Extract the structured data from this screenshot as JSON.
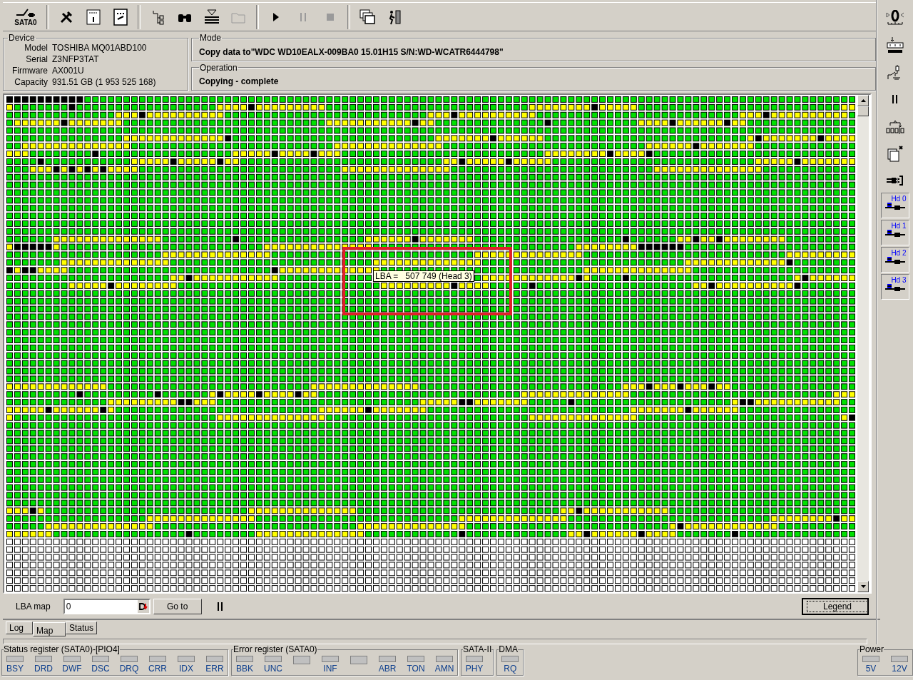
{
  "toolbar": {
    "port_button": {
      "label": "SATA0"
    },
    "buttons": [
      {
        "kind": "tools",
        "disabled": false
      },
      {
        "kind": "info",
        "disabled": false
      },
      {
        "kind": "percent",
        "disabled": false
      },
      {
        "kind": "tree",
        "disabled": false
      },
      {
        "kind": "binoculars",
        "disabled": false
      },
      {
        "kind": "stack",
        "disabled": false
      },
      {
        "kind": "folder",
        "disabled": true
      },
      {
        "kind": "play",
        "disabled": false
      },
      {
        "kind": "pause",
        "disabled": true
      },
      {
        "kind": "stop",
        "disabled": true
      },
      {
        "kind": "windows",
        "disabled": false
      },
      {
        "kind": "exit",
        "disabled": false
      }
    ]
  },
  "device": {
    "title": "Device",
    "fields": [
      {
        "label": "Model",
        "value": "TOSHIBA MQ01ABD100"
      },
      {
        "label": "Serial",
        "value": "Z3NFP3TAT"
      },
      {
        "label": "Firmware",
        "value": "AX001U"
      },
      {
        "label": "Capacity",
        "value": "931.51 GB (1 953 525 168)"
      }
    ]
  },
  "mode": {
    "title": "Mode",
    "text": "Copy data to\"WDC WD10EALX-009BA0 15.01H15 S/N:WD-WCATR6444798\""
  },
  "operation": {
    "title": "Operation",
    "text": "Copying - complete"
  },
  "map": {
    "tooltip": "LBA =   507 749 (Head 3)"
  },
  "map_controls": {
    "label": "LBA map",
    "value": "0",
    "go_button": "Go to",
    "legend_button": "Legend"
  },
  "tabs": [
    {
      "label": "Log",
      "selected": false
    },
    {
      "label": "Map",
      "selected": true
    },
    {
      "label": "Status",
      "selected": false
    }
  ],
  "side_toolbar": {
    "buttons": [
      {
        "kind": "zero"
      },
      {
        "kind": "reset"
      },
      {
        "kind": "switch"
      },
      {
        "kind": "pause"
      },
      {
        "kind": "counter"
      },
      {
        "kind": "pages"
      },
      {
        "kind": "cable"
      }
    ],
    "heads": [
      {
        "label": "Hd 0"
      },
      {
        "label": "Hd 1"
      },
      {
        "label": "Hd 2"
      },
      {
        "label": "Hd 3"
      }
    ]
  },
  "registers": [
    {
      "title": "Status register (SATA0)-[PIO4]",
      "indicators": [
        {
          "label": "BSY"
        },
        {
          "label": "DRD"
        },
        {
          "label": "DWF"
        },
        {
          "label": "DSC"
        },
        {
          "label": "DRQ"
        },
        {
          "label": "CRR"
        },
        {
          "label": "IDX"
        },
        {
          "label": "ERR"
        }
      ]
    },
    {
      "title": "Error register (SATA0)",
      "indicators": [
        {
          "label": "BBK"
        },
        {
          "label": "UNC"
        },
        {
          "kind": "unlabeled"
        },
        {
          "label": "INF"
        },
        {
          "kind": "unlabeled"
        },
        {
          "label": "ABR"
        },
        {
          "label": "TON"
        },
        {
          "label": "AMN"
        }
      ]
    },
    {
      "title": "SATA-II",
      "indicators": [
        {
          "label": "PHY"
        }
      ]
    },
    {
      "title": "DMA",
      "indicators": [
        {
          "label": "RQ"
        }
      ]
    },
    {
      "title": "Power",
      "indicators": [
        {
          "label": "5V"
        },
        {
          "label": "12V"
        }
      ]
    }
  ]
}
